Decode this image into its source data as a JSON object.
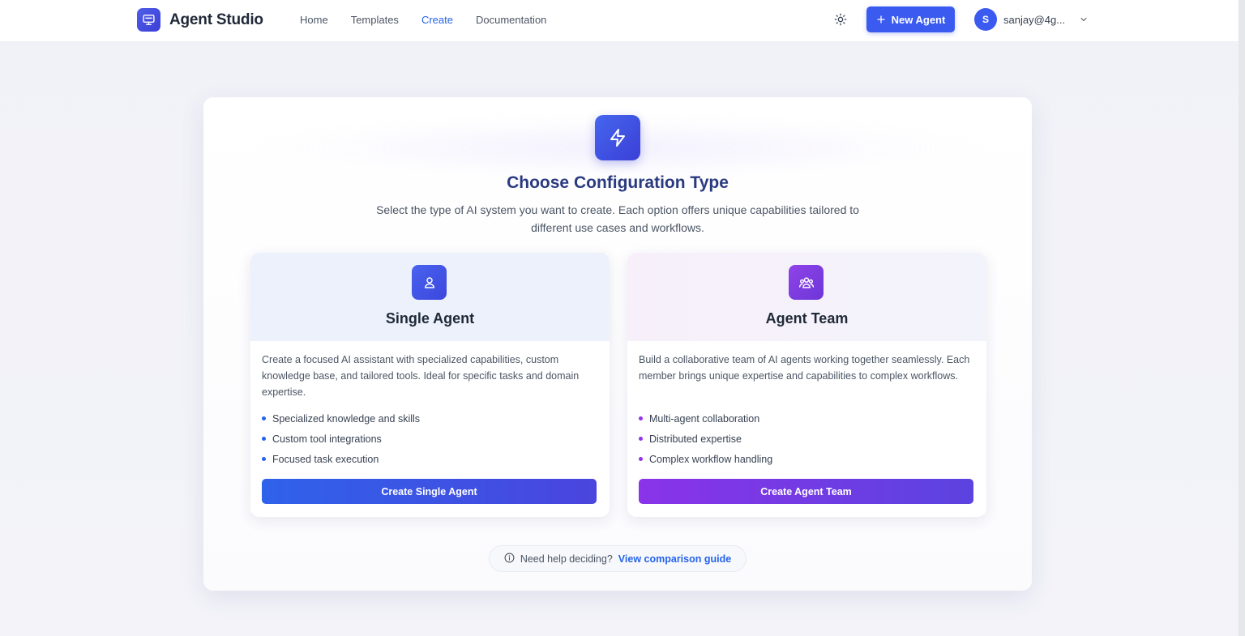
{
  "header": {
    "brand": "Agent Studio",
    "nav": [
      {
        "label": "Home"
      },
      {
        "label": "Templates"
      },
      {
        "label": "Create"
      },
      {
        "label": "Documentation"
      }
    ],
    "active_nav": "Create",
    "new_agent_label": "New Agent",
    "user": {
      "initial": "S",
      "email": "sanjay@4g..."
    }
  },
  "main": {
    "title": "Choose Configuration Type",
    "subtitle": "Select the type of AI system you want to create. Each option offers unique capabilities tailored to different use cases and workflows.",
    "cards": [
      {
        "title": "Single Agent",
        "description": "Create a focused AI assistant with specialized capabilities, custom knowledge base, and tailored tools. Ideal for specific tasks and domain expertise.",
        "features": [
          "Specialized knowledge and skills",
          "Custom tool integrations",
          "Focused task execution"
        ],
        "button": "Create Single Agent",
        "icon": "user-icon"
      },
      {
        "title": "Agent Team",
        "description": "Build a collaborative team of AI agents working together seamlessly. Each member brings unique expertise and capabilities to complex workflows.",
        "features": [
          "Multi-agent collaboration",
          "Distributed expertise",
          "Complex workflow handling"
        ],
        "button": "Create Agent Team",
        "icon": "users-icon"
      }
    ],
    "help": {
      "text": "Need help deciding?",
      "link": "View comparison guide"
    }
  },
  "colors": {
    "primary": "#3b5bf0",
    "purple": "#8a33e8",
    "title": "#2a3a80",
    "link": "#2563eb"
  }
}
